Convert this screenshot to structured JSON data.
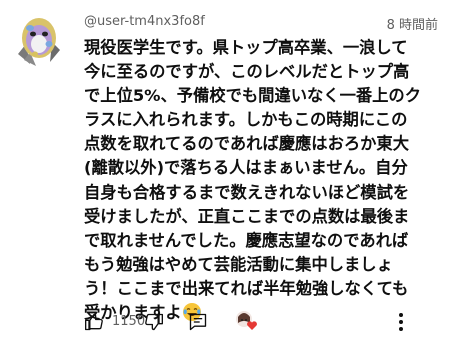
{
  "comment": {
    "username": "@user-tm4nx3fo8f",
    "timestamp": "8 時間前",
    "lines": [
      "現役医学生です。県トップ高卒業、一浪して",
      "今に至るのですが、このレベルだとトップ高",
      "で上位5%、予備校でも間違いなく一番上のク",
      "ラスに入れられます。しかもこの時期にこの",
      "点数を取れてるのであれば慶應はおろか東大",
      "(離散以外)で落ちる人はまぁいません。自分",
      "自身も合格するまで数えきれないほど模試を",
      "受けましたが、正直ここまでの点数は最後ま",
      "で取れませんでした。慶應志望なのであれば",
      "もう勉強はやめて芸能活動に集中しましょ",
      "う！ここまで出来てれば半年勉強しなくても",
      "受かりますよ"
    ],
    "emoji": "laughing-with-tears-emoji",
    "like_count": "1150"
  },
  "colors": {
    "text": "#0f0f0f",
    "secondary": "#606060",
    "heart": "#e53935"
  }
}
